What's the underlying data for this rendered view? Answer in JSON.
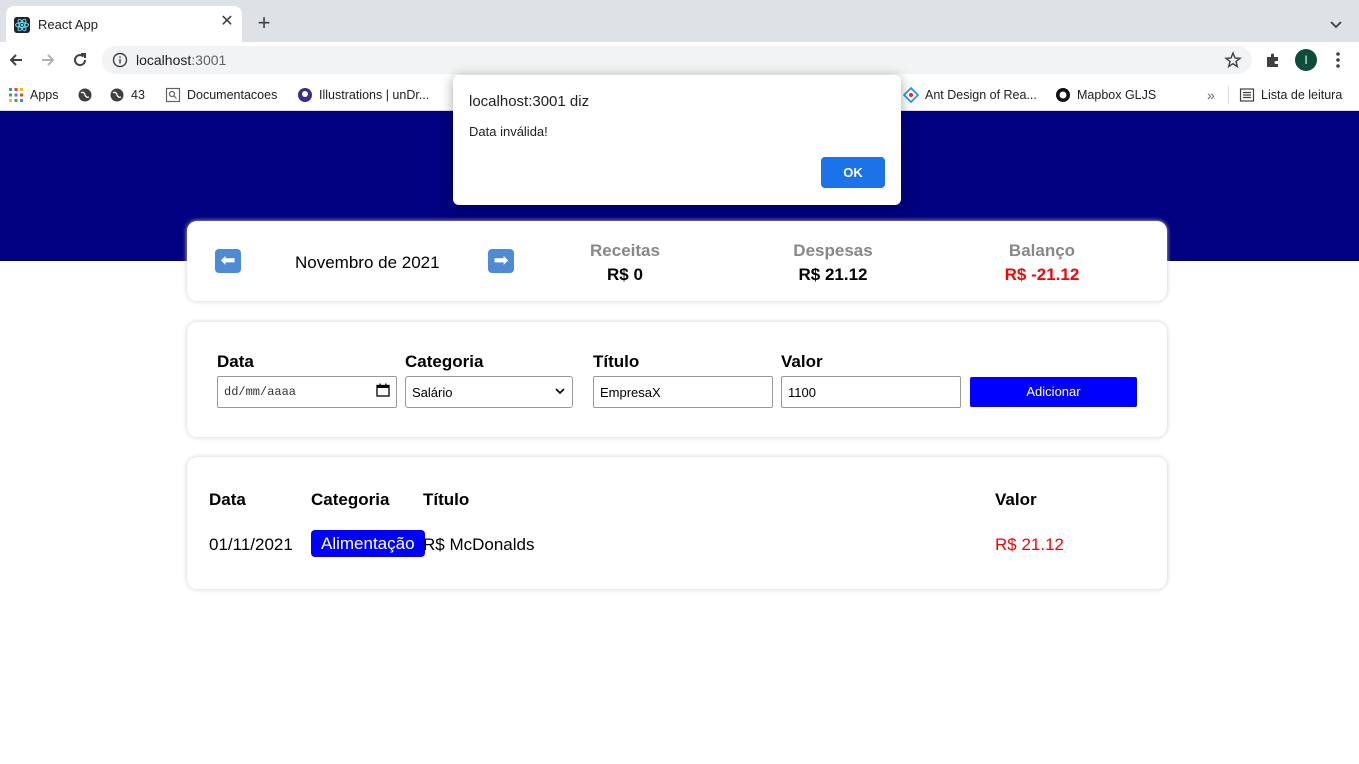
{
  "browser": {
    "tab_title": "React App",
    "url_host": "localhost",
    "url_port": ":3001",
    "profile_initial": "I",
    "bookmarks": {
      "apps": "Apps",
      "b2": "43",
      "b3": "Documentacoes",
      "b4": "Illustrations | unDr...",
      "b5": "Ant Design of Rea...",
      "b6": "Mapbox GLJS",
      "more": "»",
      "reading_list": "Lista de leitura"
    }
  },
  "dialog": {
    "title": "localhost:3001 diz",
    "message": "Data inválida!",
    "ok_label": "OK"
  },
  "info": {
    "prev_arrow": "⬅",
    "month": "Novembro de 2021",
    "next_arrow": "➡",
    "income_label": "Receitas",
    "income_value": "R$ 0",
    "expense_label": "Despesas",
    "expense_value": "R$ 21.12",
    "balance_label": "Balanço",
    "balance_value": "R$ -21.12"
  },
  "form": {
    "date_label": "Data",
    "date_placeholder": "dd/mm/aaaa",
    "category_label": "Categoria",
    "category_value": "Salário",
    "title_label": "Título",
    "title_value": "EmpresaX",
    "value_label": "Valor",
    "value_value": "1100",
    "add_label": "Adicionar"
  },
  "table": {
    "headers": {
      "date": "Data",
      "category": "Categoria",
      "title": "Título",
      "value": "Valor"
    },
    "rows": [
      {
        "date": "01/11/2021",
        "category": "Alimentação",
        "title": "R$ McDonalds",
        "value": "R$ 21.12"
      }
    ]
  },
  "colors": {
    "header_band": "#000080",
    "accent_button": "#0000ff",
    "negative": "#ff0000",
    "dialog_ok": "#1a73e8"
  }
}
